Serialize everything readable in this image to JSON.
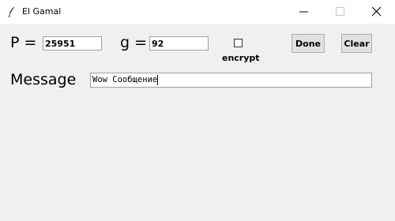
{
  "window": {
    "title": "El Gamal",
    "app_icon": "feather-icon",
    "controls": [
      "minimize-icon",
      "maximize-icon",
      "close-icon"
    ]
  },
  "form": {
    "p_label": "P =",
    "p_value": "25951",
    "g_label": "g =",
    "g_value": "92",
    "encrypt_label": "encrypt",
    "encrypt_checked": false,
    "done_label": "Done",
    "clear_label": "Clear",
    "message_label": "Message",
    "message_value": "Wow Сообщение"
  }
}
